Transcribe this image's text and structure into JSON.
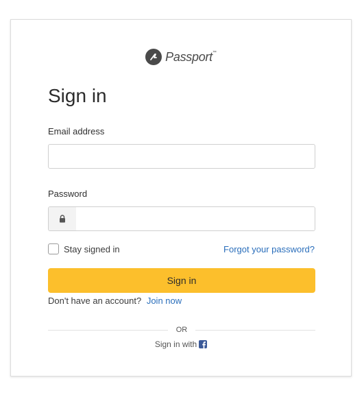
{
  "brand": {
    "name": "Passport",
    "tm": "™",
    "color": "#4a4a4a"
  },
  "title": "Sign in",
  "form": {
    "email_label": "Email address",
    "email_value": "",
    "password_label": "Password",
    "password_value": "",
    "remember_label": "Stay signed in",
    "remember_checked": false,
    "forgot_label": "Forgot your password?",
    "submit_label": "Sign in"
  },
  "signup": {
    "prompt": "Don't have an account?",
    "link_label": "Join now"
  },
  "divider": "OR",
  "social": {
    "label": "Sign in with",
    "provider_icon": "facebook-icon"
  },
  "colors": {
    "accent": "#fcbf2c",
    "link": "#2a6ebb",
    "facebook": "#3b5998"
  }
}
